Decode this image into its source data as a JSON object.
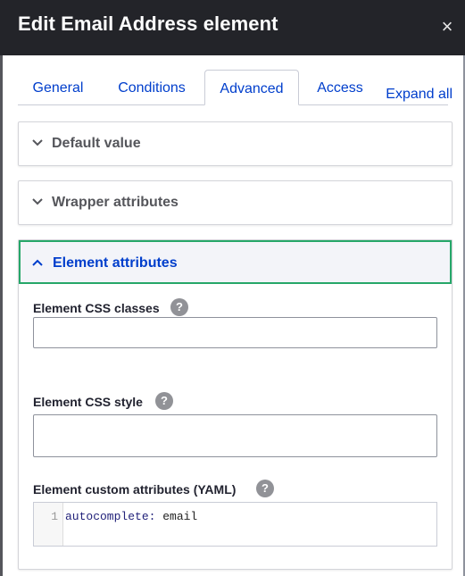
{
  "dialog": {
    "title": "Edit Email Address element",
    "close_glyph": "×"
  },
  "tabs": [
    {
      "label": "General"
    },
    {
      "label": "Conditions"
    },
    {
      "label": "Advanced",
      "active": true
    },
    {
      "label": "Access"
    }
  ],
  "expand_all": "Expand all",
  "panels": {
    "default_value": {
      "label": "Default value",
      "expanded": false
    },
    "wrapper_attributes": {
      "label": "Wrapper attributes",
      "expanded": false
    },
    "element_attributes": {
      "label": "Element attributes",
      "expanded": true
    }
  },
  "fields": {
    "css_classes": {
      "label": "Element CSS classes",
      "value": "",
      "help": "?"
    },
    "css_style": {
      "label": "Element CSS style",
      "value": "",
      "help": "?"
    },
    "custom_attributes": {
      "label": "Element custom attributes (YAML)",
      "help": "?",
      "line_number": "1",
      "code_key": "autocomplete:",
      "code_value": " email"
    }
  },
  "colors": {
    "titlebar": "#232429",
    "link": "#003ecc",
    "focus_border": "#26a769"
  },
  "icons": {
    "close": "close-icon",
    "collapsed": "chevron-down-icon",
    "expanded": "chevron-up-icon",
    "help": "help-icon"
  }
}
